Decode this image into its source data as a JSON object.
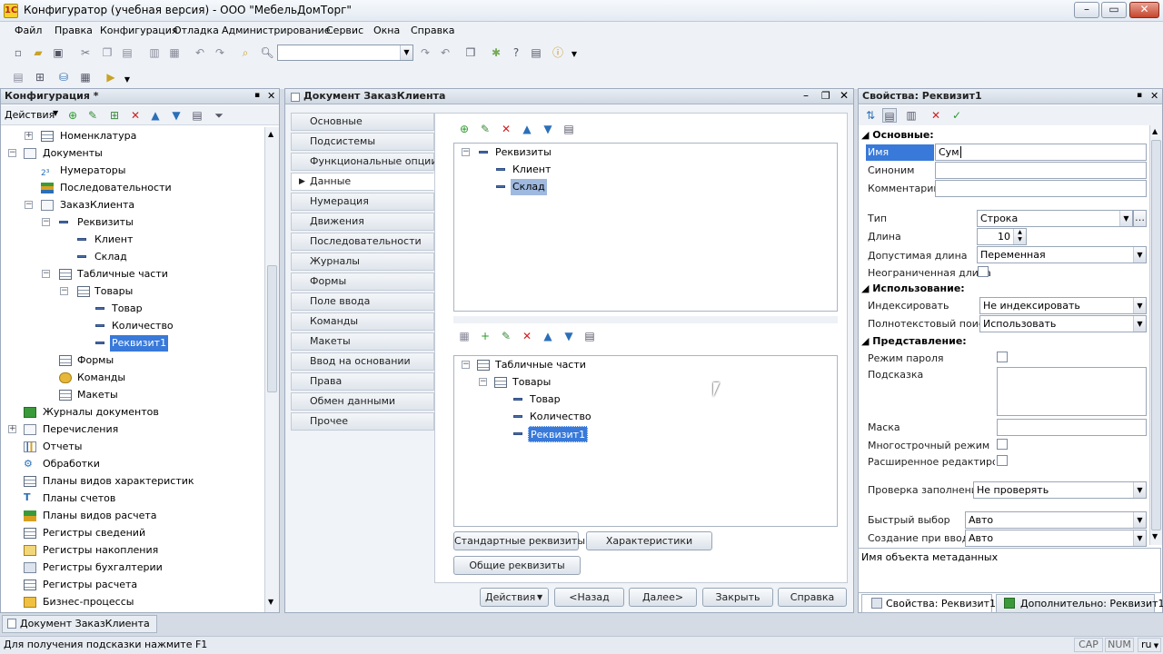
{
  "window": {
    "title": "Конфигуратор (учебная версия) - ООО \"МебельДомТорг\""
  },
  "menu": [
    "Файл",
    "Правка",
    "Конфигурация",
    "Отладка",
    "Администрирование",
    "Сервис",
    "Окна",
    "Справка"
  ],
  "config_panel": {
    "title": "Конфигурация *",
    "actions_label": "Действия",
    "tree": [
      "Номенклатура",
      "Документы",
      "Нумераторы",
      "Последовательности",
      "ЗаказКлиента",
      "Реквизиты",
      "Клиент",
      "Склад",
      "Табличные части",
      "Товары",
      "Товар",
      "Количество",
      "Реквизит1",
      "Формы",
      "Команды",
      "Макеты",
      "Журналы документов",
      "Перечисления",
      "Отчеты",
      "Обработки",
      "Планы видов характеристик",
      "Планы счетов",
      "Планы видов расчета",
      "Регистры сведений",
      "Регистры накопления",
      "Регистры бухгалтерии",
      "Регистры расчета",
      "Бизнес-процессы"
    ]
  },
  "document_window": {
    "title": "Документ ЗаказКлиента",
    "nav_tabs": [
      "Основные",
      "Подсистемы",
      "Функциональные опции",
      "Данные",
      "Нумерация",
      "Движения",
      "Последовательности",
      "Журналы",
      "Формы",
      "Поле ввода",
      "Команды",
      "Макеты",
      "Ввод на основании",
      "Права",
      "Обмен данными",
      "Прочее"
    ],
    "attributes_tree": [
      "Реквизиты",
      "Клиент",
      "Склад"
    ],
    "tabular_tree": [
      "Табличные части",
      "Товары",
      "Товар",
      "Количество",
      "Реквизит1"
    ],
    "buttons": {
      "standard": "Стандартные реквизиты",
      "characteristics": "Характеристики",
      "common": "Общие реквизиты",
      "actions": "Действия",
      "back": "<Назад",
      "next": "Далее>",
      "close": "Закрыть",
      "help": "Справка"
    }
  },
  "properties": {
    "title": "Свойства: Реквизит1",
    "sections": {
      "basic": "Основные:",
      "usage": "Использование:",
      "presentation": "Представление:"
    },
    "labels": {
      "name": "Имя",
      "synonym": "Синоним",
      "comment": "Комментарий",
      "type": "Тип",
      "length": "Длина",
      "allowed_length": "Допустимая длина",
      "unlimited": "Неограниченная длина",
      "index": "Индексировать",
      "fulltext": "Полнотекстовый поиск",
      "password": "Режим пароля",
      "tooltip": "Подсказка",
      "mask": "Маска",
      "multiline": "Многострочный режим",
      "extended": "Расширенное редактирование",
      "fill_check": "Проверка заполнения",
      "quick_choice": "Быстрый выбор",
      "create_on_input": "Создание при вводе"
    },
    "values": {
      "name": "Сум",
      "type": "Строка",
      "length": "10",
      "allowed_length": "Переменная",
      "index": "Не индексировать",
      "fulltext": "Использовать",
      "fill_check": "Не проверять",
      "quick_choice": "Авто",
      "create_on_input": "Авто"
    },
    "description": "Имя объекта метаданных",
    "bottom_tabs": [
      "Свойства: Реквизит1",
      "Дополнительно: Реквизит1"
    ]
  },
  "taskbar": {
    "item": "Документ ЗаказКлиента"
  },
  "status": {
    "hint": "Для получения подсказки нажмите F1",
    "cap": "CAP",
    "num": "NUM",
    "lang": "ru"
  }
}
